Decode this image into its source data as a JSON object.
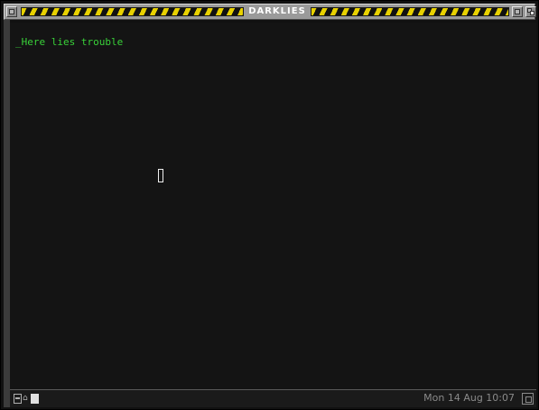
{
  "window": {
    "title": "DARKLIES"
  },
  "terminal": {
    "cursor_char": "_",
    "line_text": "Here lies trouble"
  },
  "statusbar": {
    "lock_glyph": "⌂",
    "clock": "Mon 14 Aug 10:07"
  },
  "colors": {
    "background": "#141414",
    "text": "#39d239",
    "hazard_yellow": "#e8d100"
  }
}
